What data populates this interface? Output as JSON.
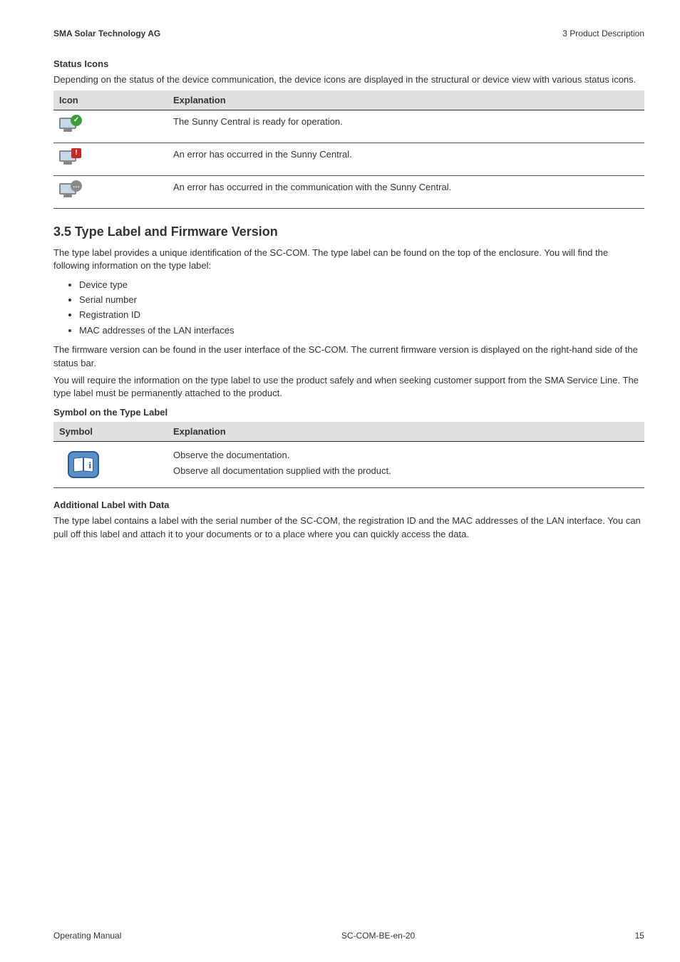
{
  "header": {
    "company": "SMA Solar Technology AG",
    "section": "3  Product Description"
  },
  "status_icons": {
    "heading": "Status Icons",
    "intro": "Depending on the status of the device communication, the device icons are displayed in the structural or device view with various status icons.",
    "col_icon": "Icon",
    "col_explanation": "Explanation",
    "rows": [
      "The Sunny Central is ready for operation.",
      "An error has occurred in the Sunny Central.",
      "An error has occurred in the communication with the Sunny Central."
    ]
  },
  "section35": {
    "heading": "3.5    Type Label and Firmware Version",
    "para1": "The type label provides a unique identification of the SC-COM. The type label can be found on the top of the enclosure. You will find the following information on the type label:",
    "bullets": [
      "Device type",
      "Serial number",
      "Registration ID",
      "MAC addresses of the LAN interfaces"
    ],
    "para2": "The firmware version can be found in the user interface of the SC-COM. The current firmware version is displayed on the right-hand side of the status bar.",
    "para3": "You will require the information on the type label to use the product safely and when seeking customer support from the SMA Service Line. The type label must be permanently attached to the product."
  },
  "symbol_label": {
    "heading": "Symbol on the Type Label",
    "col_symbol": "Symbol",
    "col_explanation": "Explanation",
    "exp_line1": "Observe the documentation.",
    "exp_line2": "Observe all documentation supplied with the product."
  },
  "additional_label": {
    "heading": "Additional Label with Data",
    "para": "The type label contains a label with the serial number of the SC-COM, the registration ID and the MAC addresses of the LAN interface. You can pull off this label and attach it to your documents or to a place where you can quickly access the data."
  },
  "footer": {
    "left": "Operating Manual",
    "center": "SC-COM-BE-en-20",
    "right": "15"
  }
}
